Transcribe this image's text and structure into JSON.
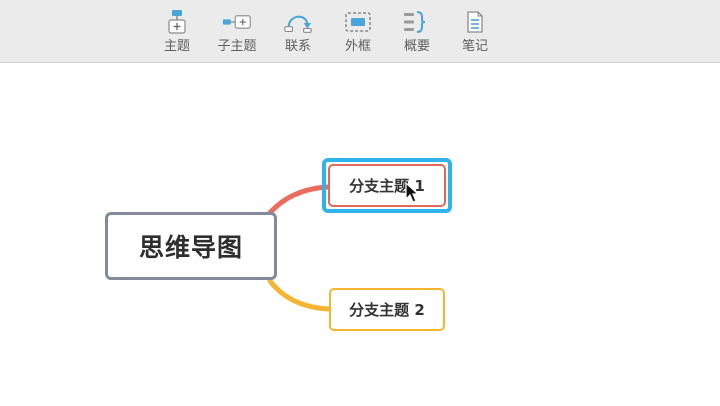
{
  "toolbar": {
    "items": [
      {
        "label": "主题",
        "icon": "topic-icon"
      },
      {
        "label": "子主题",
        "icon": "subtopic-icon"
      },
      {
        "label": "联系",
        "icon": "relationship-icon"
      },
      {
        "label": "外框",
        "icon": "boundary-icon"
      },
      {
        "label": "概要",
        "icon": "summary-icon"
      },
      {
        "label": "笔记",
        "icon": "notes-icon"
      }
    ]
  },
  "mindmap": {
    "central": "思维导图",
    "branches": [
      {
        "label": "分支主题 1",
        "color": "#e06a5d",
        "selected": true
      },
      {
        "label": "分支主题 2",
        "color": "#f5b530",
        "selected": false
      }
    ]
  },
  "colors": {
    "selection": "#2eb3ea",
    "central_border": "#848a9a",
    "toolbar_bg": "#ebebeb",
    "icon_blue": "#4aa6d8"
  }
}
